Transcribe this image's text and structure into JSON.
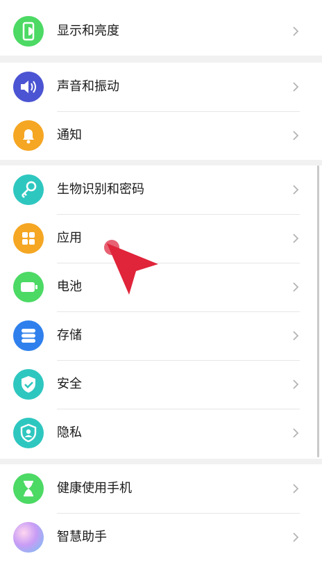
{
  "items": [
    {
      "label": "显示和亮度",
      "icon": "phone-brightness-icon",
      "color": "#4cd964"
    },
    {
      "label": "声音和振动",
      "icon": "speaker-icon",
      "color": "#4b54d2"
    },
    {
      "label": "通知",
      "icon": "bell-icon",
      "color": "#f5a623"
    },
    {
      "label": "生物识别和密码",
      "icon": "key-icon",
      "color": "#2ec7c0"
    },
    {
      "label": "应用",
      "icon": "apps-grid-icon",
      "color": "#f5a623"
    },
    {
      "label": "电池",
      "icon": "battery-icon",
      "color": "#4cd964"
    },
    {
      "label": "存储",
      "icon": "storage-icon",
      "color": "#2f80ed"
    },
    {
      "label": "安全",
      "icon": "shield-check-icon",
      "color": "#2ec7c0"
    },
    {
      "label": "隐私",
      "icon": "privacy-shield-icon",
      "color": "#2ec7c0"
    },
    {
      "label": "健康使用手机",
      "icon": "hourglass-icon",
      "color": "#4cd964"
    },
    {
      "label": "智慧助手",
      "icon": "assistant-orb-icon",
      "color": "#b48cf0"
    }
  ],
  "colors": {
    "background": "#f1f1f1",
    "card": "#ffffff",
    "chevron": "#b3b3b3",
    "pointer": "#e0243a"
  }
}
